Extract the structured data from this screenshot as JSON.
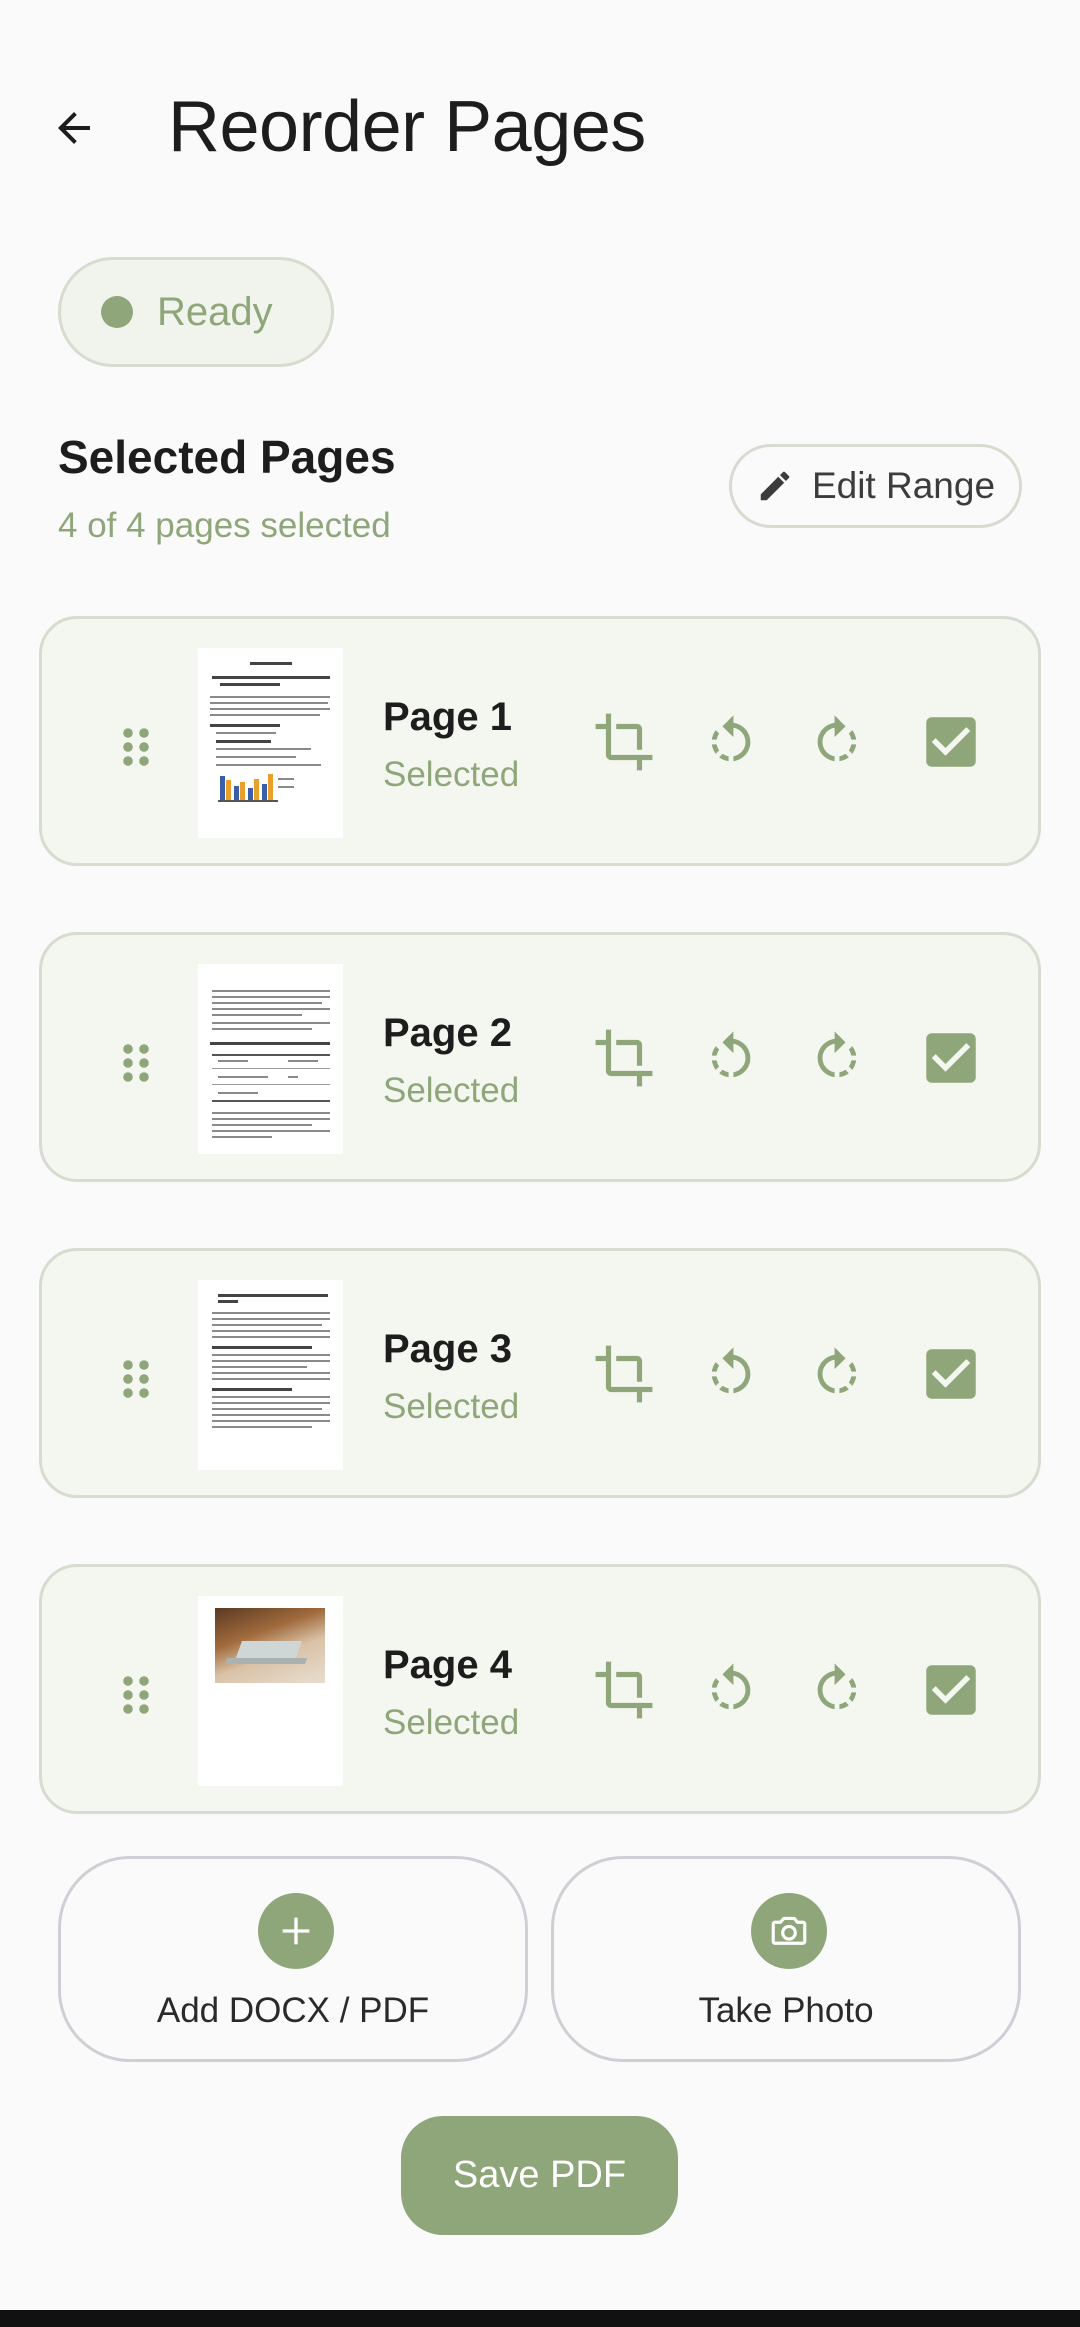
{
  "header": {
    "title": "Reorder Pages",
    "back_icon": "arrow-left-icon"
  },
  "status": {
    "label": "Ready",
    "dot_color": "#8fa67a"
  },
  "section": {
    "title": "Selected Pages",
    "subtitle": "4 of 4 pages selected",
    "edit_range_label": "Edit Range",
    "edit_icon": "pencil-icon"
  },
  "pages": [
    {
      "name": "Page 1",
      "status": "Selected",
      "checked": true,
      "thumbnail": "document-with-bar-chart"
    },
    {
      "name": "Page 2",
      "status": "Selected",
      "checked": true,
      "thumbnail": "document-with-table"
    },
    {
      "name": "Page 3",
      "status": "Selected",
      "checked": true,
      "thumbnail": "text-document"
    },
    {
      "name": "Page 4",
      "status": "Selected",
      "checked": true,
      "thumbnail": "document-with-photo"
    }
  ],
  "page_actions": [
    "crop-icon",
    "rotate-left-icon",
    "rotate-right-icon",
    "checkbox-icon"
  ],
  "actions": {
    "add_label": "Add DOCX / PDF",
    "photo_label": "Take Photo",
    "save_label": "Save PDF"
  },
  "colors": {
    "accent": "#8fa67a",
    "card_bg": "#f4f6f0",
    "card_border": "#d6dccf",
    "background": "#fafafa"
  }
}
